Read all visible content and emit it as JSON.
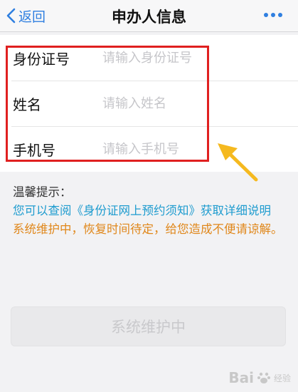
{
  "header": {
    "back_label": "返回",
    "title": "申办人信息",
    "more_icon": "more-dots-icon"
  },
  "form": {
    "fields": [
      {
        "label": "身份证号",
        "placeholder": "请输入身份证号",
        "value": ""
      },
      {
        "label": "姓名",
        "placeholder": "请输入姓名",
        "value": ""
      },
      {
        "label": "手机号",
        "placeholder": "请输入手机号",
        "value": ""
      }
    ]
  },
  "tips": {
    "title": "温馨提示：",
    "link_text": "您可以查阅《身份证网上预约须知》获取详细说明",
    "warning_text": "系统维护中，恢复时间待定，给您造成不便请谅解。"
  },
  "submit": {
    "label": "系统维护中",
    "disabled": true
  },
  "watermark": {
    "text": "Bai",
    "sub": "经验"
  },
  "colors": {
    "accent": "#2f7fe0",
    "link": "#1f9ccf",
    "warning": "#e0871a",
    "highlight": "#e02020",
    "arrow": "#f5b91f"
  }
}
